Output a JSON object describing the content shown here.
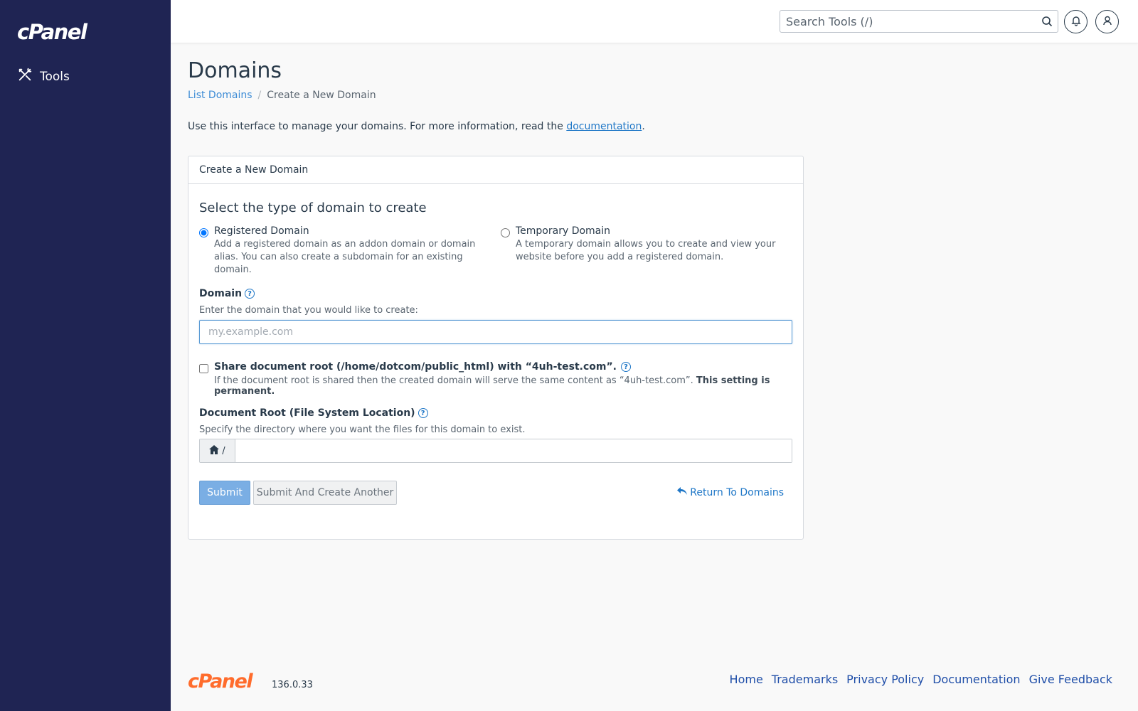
{
  "sidebar": {
    "logo": "cPanel",
    "items": [
      {
        "label": "Tools",
        "icon": "tools-icon"
      }
    ]
  },
  "topbar": {
    "search_placeholder": "Search Tools (/)"
  },
  "page": {
    "title": "Domains",
    "breadcrumb": [
      "List Domains",
      "/",
      "Create a New Domain"
    ],
    "intro_text": "Use this interface to manage your domains. For more information, read the ",
    "intro_link": "documentation",
    "intro_end": "."
  },
  "card": {
    "header": "Create a New Domain",
    "section_title": "Select the type of domain to create",
    "options": [
      {
        "label": "Registered Domain",
        "desc": "Add a registered domain as an addon domain or domain alias. You can also create a subdomain for an existing domain.",
        "selected": true
      },
      {
        "label": "Temporary Domain",
        "desc": "A temporary domain allows you to create and view your website before you add a registered domain.",
        "selected": false
      }
    ],
    "domain_label": "Domain",
    "domain_hint": "Enter the domain that you would like to create:",
    "domain_placeholder": "my.example.com",
    "domain_value": "",
    "share_label": "Share document root (/home/dotcom/public_html) with “4uh-test.com”.",
    "share_desc": "If the document root is shared then the created domain will serve the same content as “4uh-test.com”. ",
    "share_desc_bold": "This setting is permanent.",
    "share_checked": false,
    "docroot_label": "Document Root (File System Location)",
    "docroot_hint": "Specify the directory where you want the files for this domain to exist.",
    "docroot_prefix": "/",
    "docroot_value": "",
    "submit_label": "Submit",
    "submit_another_label": "Submit And Create Another",
    "return_label": "Return To Domains",
    "help_glyph": "?"
  },
  "footer": {
    "logo": "cPanel",
    "version": "136.0.33",
    "links": [
      "Home",
      "Trademarks",
      "Privacy Policy",
      "Documentation",
      "Give Feedback"
    ]
  },
  "colors": {
    "sidebar_bg": "#1f2453",
    "accent": "#1f77c7",
    "brand_orange": "#ff6c2c"
  }
}
